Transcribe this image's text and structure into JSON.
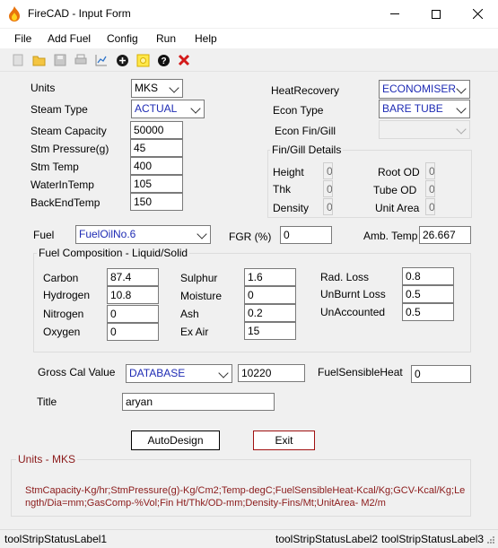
{
  "window": {
    "title": "FireCAD - Input Form"
  },
  "menu": [
    "File",
    "Add Fuel",
    "Config",
    "Run",
    "Help"
  ],
  "toolbar_icons": [
    "new-icon",
    "open-icon",
    "save-icon",
    "print-icon",
    "chart-icon",
    "add-icon",
    "light-icon",
    "help-icon",
    "close-icon"
  ],
  "left": {
    "units_label": "Units",
    "units_value": "MKS",
    "steam_type_label": "Steam Type",
    "steam_type_value": "ACTUAL",
    "steam_capacity_label": "Steam Capacity",
    "steam_capacity_value": "50000",
    "stm_pressure_label": "Stm Pressure(g)",
    "stm_pressure_value": "45",
    "stm_temp_label": "Stm Temp",
    "stm_temp_value": "400",
    "water_in_temp_label": "WaterInTemp",
    "water_in_temp_value": "105",
    "back_end_temp_label": "BackEndTemp",
    "back_end_temp_value": "150"
  },
  "right": {
    "heat_recovery_label": "HeatRecovery",
    "heat_recovery_value": "ECONOMISER",
    "econ_type_label": "Econ Type",
    "econ_type_value": "BARE TUBE",
    "econ_fin_label": "Econ Fin/Gill",
    "fin_group_title": "Fin/Gill Details",
    "height_label": "Height",
    "height_value": "0",
    "thk_label": "Thk",
    "thk_value": "0",
    "density_label": "Density",
    "density_value": "0",
    "root_od_label": "Root OD",
    "root_od_value": "0",
    "tube_od_label": "Tube OD",
    "tube_od_value": "0",
    "unit_area_label": "Unit Area",
    "unit_area_value": "0"
  },
  "fuel": {
    "fuel_label": "Fuel",
    "fuel_value": "FuelOilNo.6",
    "fgr_label": "FGR (%)",
    "fgr_value": "0",
    "amb_temp_label": "Amb. Temp",
    "amb_temp_value": "26.667",
    "group_title": "Fuel Composition - Liquid/Solid",
    "carbon_label": "Carbon",
    "carbon_value": "87.4",
    "hydrogen_label": "Hydrogen",
    "hydrogen_value": "10.8",
    "nitrogen_label": "Nitrogen",
    "nitrogen_value": "0",
    "oxygen_label": "Oxygen",
    "oxygen_value": "0",
    "sulphur_label": "Sulphur",
    "sulphur_value": "1.6",
    "moisture_label": "Moisture",
    "moisture_value": "0",
    "ash_label": "Ash",
    "ash_value": "0.2",
    "ex_air_label": "Ex Air",
    "ex_air_value": "15",
    "rad_loss_label": "Rad. Loss",
    "rad_loss_value": "0.8",
    "unburnt_loss_label": "UnBurnt Loss",
    "unburnt_loss_value": "0.5",
    "unaccounted_label": "UnAccounted",
    "unaccounted_value": "0.5"
  },
  "gross": {
    "label": "Gross Cal Value",
    "source_value": "DATABASE",
    "value": "10220",
    "sensible_label": "FuelSensibleHeat",
    "sensible_value": "0"
  },
  "title_field": {
    "label": "Title",
    "value": "aryan"
  },
  "buttons": {
    "autodesign": "AutoDesign",
    "exit": "Exit"
  },
  "units_info": {
    "title": "Units - MKS",
    "text": "StmCapacity-Kg/hr;StmPressure(g)-Kg/Cm2;Temp-degC;FuelSensibleHeat-Kcal/Kg;GCV-Kcal/Kg;Length/Dia=mm;GasComp-%Vol;Fin Ht/Thk/OD-mm;Density-Fins/Mt;UnitArea- M2/m"
  },
  "status": [
    "toolStripStatusLabel1",
    "toolStripStatusLabel2",
    "toolStripStatusLabel3"
  ],
  "colors": {
    "value_blue": "#1e2bb4",
    "info_red": "#8b1a1a",
    "exit_border": "#a01010"
  }
}
